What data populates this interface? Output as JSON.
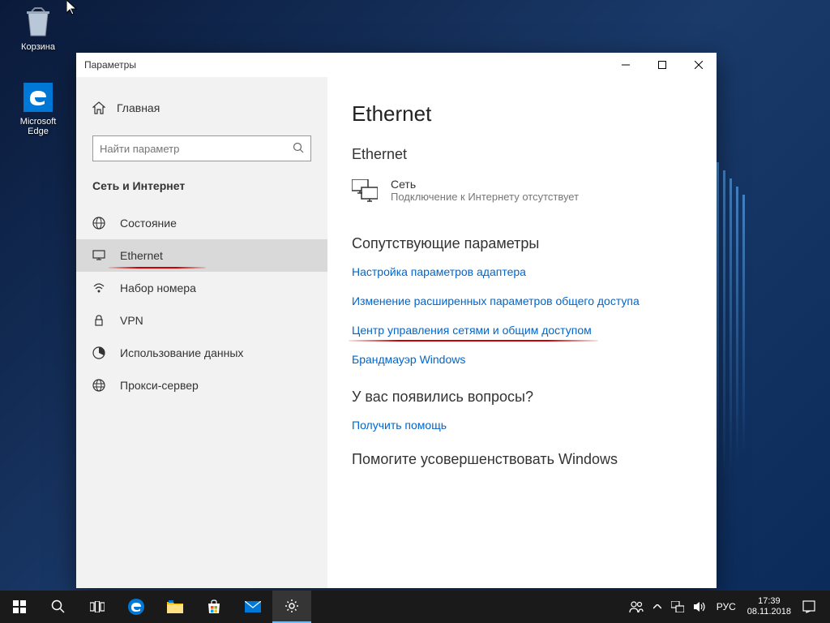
{
  "desktop": {
    "recycle_bin": "Корзина",
    "edge": "Microsoft Edge"
  },
  "window": {
    "title": "Параметры"
  },
  "sidebar": {
    "home": "Главная",
    "search_placeholder": "Найти параметр",
    "category": "Сеть и Интернет",
    "items": [
      {
        "label": "Состояние"
      },
      {
        "label": "Ethernet"
      },
      {
        "label": "Набор номера"
      },
      {
        "label": "VPN"
      },
      {
        "label": "Использование данных"
      },
      {
        "label": "Прокси-сервер"
      }
    ]
  },
  "content": {
    "title": "Ethernet",
    "section": "Ethernet",
    "network_name": "Сеть",
    "network_status": "Подключение к Интернету отсутствует",
    "related_title": "Сопутствующие параметры",
    "links": [
      "Настройка параметров адаптера",
      "Изменение расширенных параметров общего доступа",
      "Центр управления сетями и общим доступом",
      "Брандмауэр Windows"
    ],
    "questions_title": "У вас появились вопросы?",
    "help_link": "Получить помощь",
    "improve_title": "Помогите усовершенствовать Windows"
  },
  "taskbar": {
    "lang": "РУС",
    "time": "17:39",
    "date": "08.11.2018"
  }
}
